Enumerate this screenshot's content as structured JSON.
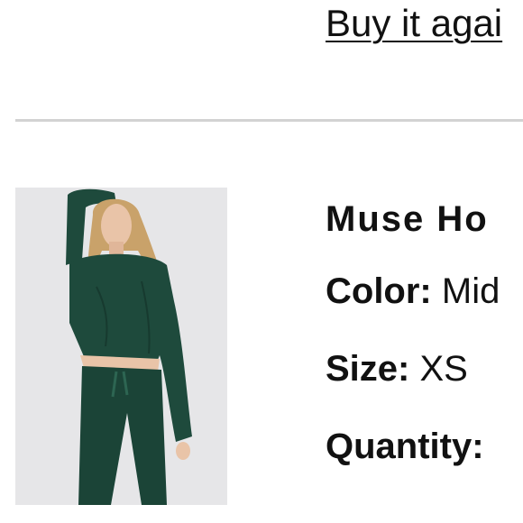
{
  "header": {
    "buy_again_label": "Buy it agai"
  },
  "product": {
    "image_icon": "product-photo",
    "name": "Muse Ho",
    "color_label": "Color:",
    "color_value": "Mid",
    "size_label": "Size:",
    "size_value": "XS",
    "quantity_label": "Quantity:"
  },
  "colors": {
    "text": "#111111",
    "divider": "#d2d2d2",
    "image_background": "#e6e6e8",
    "garment": "#1e4a3c"
  }
}
